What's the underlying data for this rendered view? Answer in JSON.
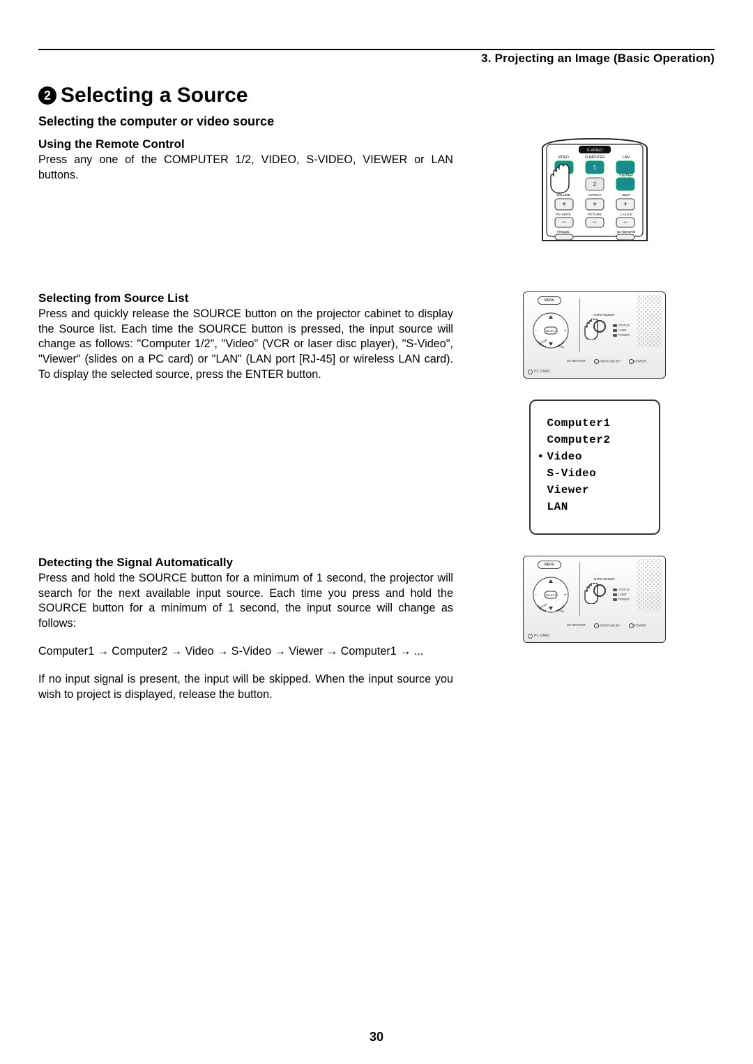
{
  "header": "3. Projecting an Image (Basic Operation)",
  "section_number": "2",
  "main_title": "Selecting a Source",
  "subheading": "Selecting the computer or video source",
  "remote_section": {
    "title": "Using the Remote Control",
    "body": "Press any one of the COMPUTER 1/2, VIDEO, S-VIDEO, VIEWER or LAN buttons."
  },
  "list_section": {
    "title": "Selecting from Source List",
    "body": "Press and quickly release the SOURCE button on the projector cabinet to display the Source list. Each time the SOURCE button is pressed, the input source will change as follows: \"Computer 1/2\", \"Video\" (VCR or laser disc player), \"S-Video\", \"Viewer\" (slides on a PC card) or \"LAN\" (LAN port [RJ-45] or wireless LAN card). To display the selected source, press the ENTER button."
  },
  "auto_section": {
    "title": "Detecting the Signal Automatically",
    "body1": "Press and hold the SOURCE button for a minimum of 1 second, the projector will search for the next available input source. Each time you press and hold the SOURCE button for a minimum of 1 second, the input source will change as follows:",
    "sequence": "Computer1 → Computer2 → Video → S-Video → Viewer → Computer1 → ...",
    "body2": "If no input signal is present, the input will be skipped. When the input source you wish to project is displayed, release the button."
  },
  "remote_labels": {
    "top": "S-VIDEO",
    "r1c1": "VIDEO",
    "r1c2": "COMPUTER",
    "r1c3": "LAN",
    "n1": "1",
    "n2": "2",
    "viewer": "VIEWER",
    "r3c1": "VOLUME",
    "r3c2": "ASPECT",
    "r3c3": "HELP",
    "r4c1": "PIC-MUTE",
    "r4c2": "PICTURE",
    "r4c3": "L-CLICK",
    "r5c1": "FREEZE",
    "r5c3": "3D REFORM"
  },
  "panel_labels": {
    "menu": "MENU",
    "select": "SELECT",
    "enter": "ENTER",
    "exit": "EXIT",
    "auto_adjust": "AUTO ADJUST",
    "reform": "3D REFORM",
    "standby": "ON/STAND BY",
    "power": "POWER",
    "status": "STATUS",
    "lamp": "LAMP",
    "pccard": "PC CARD"
  },
  "source_list": {
    "items": [
      "Computer1",
      "Computer2",
      "Video",
      "S-Video",
      "Viewer",
      "LAN"
    ],
    "selected_index": 2
  },
  "page_number": "30"
}
